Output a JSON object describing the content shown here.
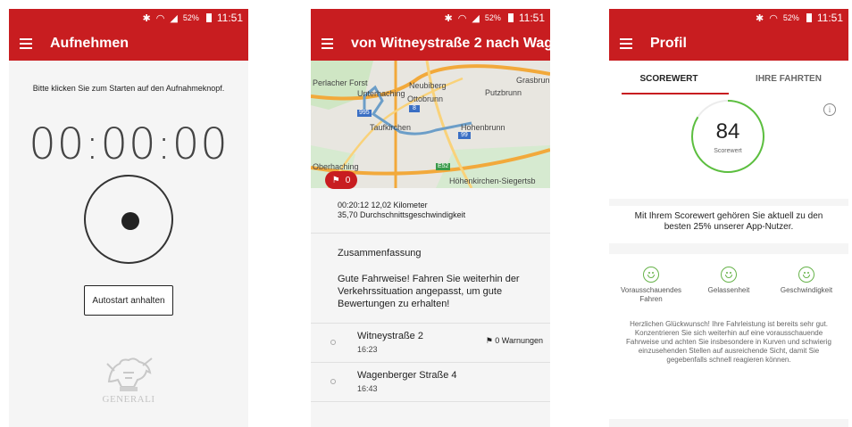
{
  "status_bar": {
    "battery": "52%",
    "time": "11:51"
  },
  "screen1": {
    "title": "Aufnehmen",
    "hint": "Bitte klicken Sie zum Starten auf den Aufnahmeknopf.",
    "timer": "00:00:00",
    "autostart_label": "Autostart anhalten",
    "logo_text": "GENERALI"
  },
  "screen2": {
    "title": "von Witneystraße 2 nach Wag...",
    "map_labels": {
      "perlacher_forst": "Perlacher Forst",
      "neubiberg": "Neubiberg",
      "grasbrunn": "Grasbrunn",
      "unterhaching": "Unterhaching",
      "putzbrunn": "Putzbrunn",
      "ottobrunn": "Ottobrunn",
      "taufkirchen": "Taufkirchen",
      "hohenbrunn": "Hohenbrunn",
      "oberhaching": "Oberhaching",
      "hoehenkirchen": "Höhenkirchen-Siegertsb",
      "road_995": "995",
      "road_8": "8",
      "road_99": "99",
      "road_e52": "E52"
    },
    "flag_count": "0",
    "stats_line1": "00:20:12   12,02 Kilometer",
    "stats_line2": "35,70 Durchschnittsgeschwindigkeit",
    "summary_title": "Zusammenfassung",
    "summary_text": "Gute Fahrweise! Fahren Sie weiterhin der Verkehrssituation angepasst, um gute Bewertungen zu erhalten!",
    "route": [
      {
        "address": "Witneystraße 2",
        "time": "16:23",
        "warnings": "0 Warnungen"
      },
      {
        "address": "Wagenberger Straße 4",
        "time": "16:43"
      }
    ]
  },
  "screen3": {
    "title": "Profil",
    "tabs": [
      "SCOREWERT",
      "IHRE FAHRTEN"
    ],
    "score": "84",
    "score_fraction": 0.84,
    "score_label": "Scorewert",
    "score_note": "Mit Ihrem Scorewert gehören Sie aktuell zu den besten 25% unserer App-Nutzer.",
    "metrics": [
      "Vorausschauendes Fahren",
      "Gelassenheit",
      "Geschwindigkeit"
    ],
    "congrats": "Herzlichen Glückwunsch! Ihre Fahrleistung ist bereits sehr gut. Konzentrieren Sie sich weiterhin auf eine vorausschauende Fahrweise und achten Sie insbesondere in Kurven und schwierig einzusehenden Stellen auf ausreichende Sicht, damit Sie gegebenfalls schnell reagieren können."
  },
  "icons": {
    "bluetooth": "bluetooth-icon",
    "wifi": "wifi-icon",
    "signal": "signal-icon",
    "battery": "battery-icon",
    "menu": "hamburger-menu-icon",
    "flag": "flag-icon",
    "info": "info-icon",
    "smiley": "smiley-icon",
    "logo": "generali-lion-logo"
  },
  "colors": {
    "accent": "#c81d20",
    "score_ring": "#5cbf3f",
    "smiley": "#67b34a",
    "route": "#6c9ec8"
  }
}
